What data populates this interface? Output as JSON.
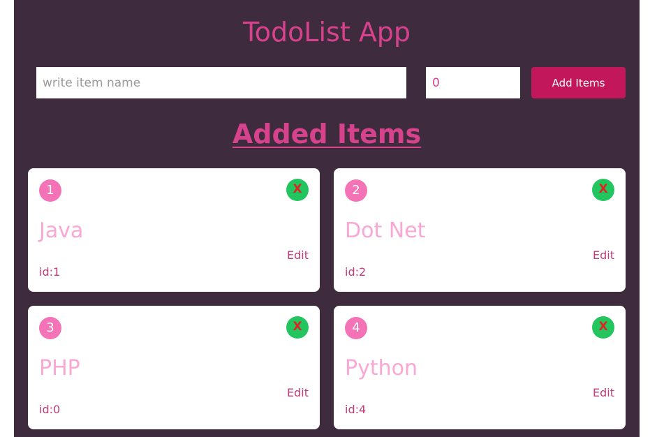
{
  "app": {
    "title": "TodoList App",
    "section_title": "Added Items"
  },
  "form": {
    "name_placeholder": "write item name",
    "name_value": "",
    "quantity_value": "0",
    "add_label": "Add Items"
  },
  "items": [
    {
      "number": "1",
      "name": "Java",
      "id_text": "id:1",
      "edit_label": "Edit",
      "delete_label": "X"
    },
    {
      "number": "2",
      "name": "Dot Net",
      "id_text": "id:2",
      "edit_label": "Edit",
      "delete_label": "X"
    },
    {
      "number": "3",
      "name": "PHP",
      "id_text": "id:0",
      "edit_label": "Edit",
      "delete_label": "X"
    },
    {
      "number": "4",
      "name": "Python",
      "id_text": "id:4",
      "edit_label": "Edit",
      "delete_label": "X"
    }
  ],
  "colors": {
    "background": "#3f2b3e",
    "accent": "#d6428c",
    "button": "#c2185b",
    "badge": "#f472b6",
    "delete": "#22c55e",
    "delete_text": "#dc2626",
    "item_name": "#f9a8d4"
  },
  "icons": {
    "delete": "close-icon"
  }
}
